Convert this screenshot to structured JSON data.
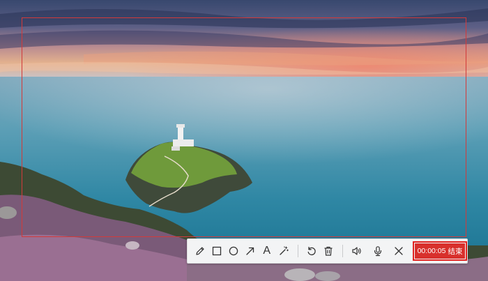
{
  "background": {
    "description_icon": "landscape-photo",
    "accent_color": "#e0211f"
  },
  "toolbar": {
    "tools": [
      {
        "name": "pencil-icon"
      },
      {
        "name": "rectangle-icon"
      },
      {
        "name": "ellipse-icon"
      },
      {
        "name": "arrow-icon"
      },
      {
        "name": "text-icon",
        "glyph": "A"
      },
      {
        "name": "magic-wand-icon"
      }
    ],
    "actions": [
      {
        "name": "undo-icon"
      },
      {
        "name": "delete-icon"
      }
    ],
    "media": [
      {
        "name": "speaker-icon"
      },
      {
        "name": "microphone-icon"
      }
    ],
    "close": {
      "name": "close-icon"
    },
    "recording": {
      "timer": "00:00:05",
      "end_label": "结束"
    }
  }
}
